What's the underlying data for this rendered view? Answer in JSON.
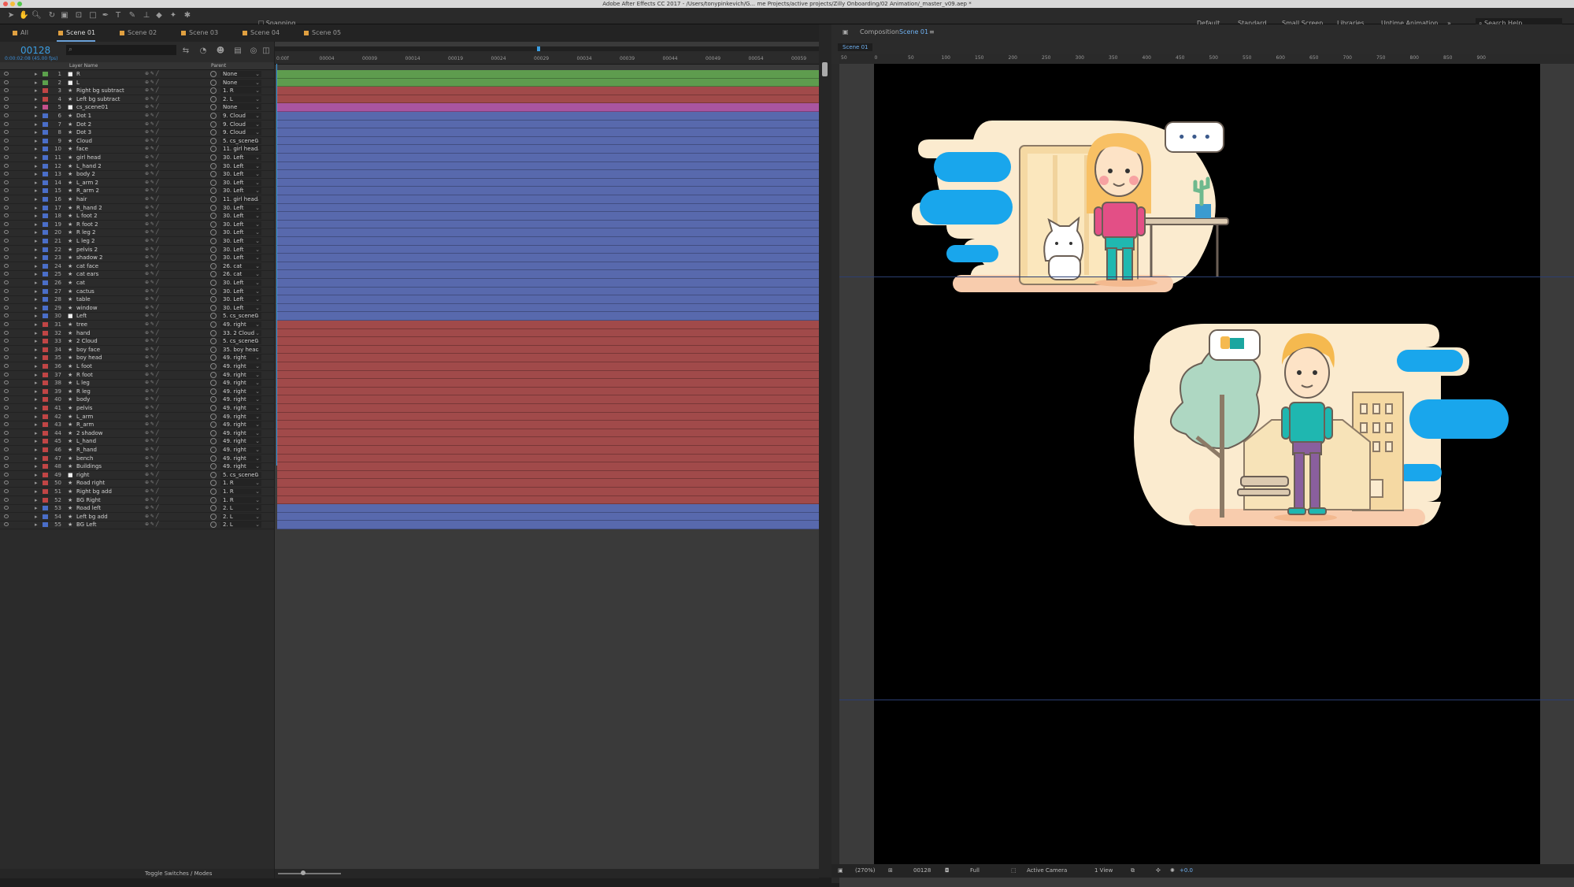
{
  "window_title": "Adobe After Effects CC 2017 - /Users/tonypinkevich/G... me Projects/active projects/Zilly Onboarding/02 Animation/_master_v09.aep *",
  "toolbar": {
    "snapping_label": "Snapping"
  },
  "workspaces": [
    "Default",
    "Standard",
    "Small Screen",
    "Libraries",
    "Untime Animation"
  ],
  "search_placeholder": "Search Help",
  "timeline_tabs": [
    {
      "label": "All",
      "color": "#e0a040"
    },
    {
      "label": "Scene 01",
      "color": "#e0a040",
      "active": true
    },
    {
      "label": "Scene 02",
      "color": "#e0a040"
    },
    {
      "label": "Scene 03",
      "color": "#e0a040"
    },
    {
      "label": "Scene 04",
      "color": "#e0a040"
    },
    {
      "label": "Scene 05",
      "color": "#e0a040"
    }
  ],
  "timecode": "00128",
  "fps_label": "0:00:02:08 (45.00 fps)",
  "layer_header": {
    "name": "Layer Name",
    "parent": "Parent"
  },
  "bottom_toggle": "Toggle Switches / Modes",
  "ruler_ticks": [
    "0:00f",
    "00004",
    "00009",
    "00014",
    "00019",
    "00024",
    "00029",
    "00034",
    "00039",
    "00044",
    "00049",
    "00054",
    "00059"
  ],
  "layers": [
    {
      "n": "1",
      "name": "R",
      "parent": "None",
      "label": "#5ca04c",
      "type": "square",
      "bar": "#5e9c4e"
    },
    {
      "n": "2",
      "name": "L",
      "parent": "None",
      "label": "#5ca04c",
      "type": "square",
      "bar": "#5e9c4e"
    },
    {
      "n": "3",
      "name": "Right bg subtract",
      "parent": "1. R",
      "label": "#c04545",
      "type": "star",
      "bar": "#a14a4a"
    },
    {
      "n": "4",
      "name": "Left bg subtract",
      "parent": "2. L",
      "label": "#c04545",
      "type": "star",
      "bar": "#a14a4a"
    },
    {
      "n": "5",
      "name": "cs_scene01",
      "parent": "None",
      "label": "#c4508c",
      "type": "square",
      "bar": "#a955a0"
    },
    {
      "n": "6",
      "name": "Dot 1",
      "parent": "9. Cloud",
      "label": "#4a6ec8",
      "type": "star",
      "bar": "#5869ad"
    },
    {
      "n": "7",
      "name": "Dot 2",
      "parent": "9. Cloud",
      "label": "#4a6ec8",
      "type": "star",
      "bar": "#5869ad"
    },
    {
      "n": "8",
      "name": "Dot 3",
      "parent": "9. Cloud",
      "label": "#4a6ec8",
      "type": "star",
      "bar": "#5869ad"
    },
    {
      "n": "9",
      "name": "Cloud",
      "parent": "5. cs_scene0",
      "label": "#4a6ec8",
      "type": "star",
      "bar": "#5869ad"
    },
    {
      "n": "10",
      "name": "face",
      "parent": "11. girl head",
      "label": "#4a6ec8",
      "type": "star",
      "bar": "#5869ad"
    },
    {
      "n": "11",
      "name": "girl head",
      "parent": "30. Left",
      "label": "#4a6ec8",
      "type": "star",
      "bar": "#5869ad"
    },
    {
      "n": "12",
      "name": "L_hand 2",
      "parent": "30. Left",
      "label": "#4a6ec8",
      "type": "star",
      "bar": "#5869ad"
    },
    {
      "n": "13",
      "name": "body 2",
      "parent": "30. Left",
      "label": "#4a6ec8",
      "type": "star",
      "bar": "#5869ad"
    },
    {
      "n": "14",
      "name": "L_arm 2",
      "parent": "30. Left",
      "label": "#4a6ec8",
      "type": "star",
      "bar": "#5869ad"
    },
    {
      "n": "15",
      "name": "R_arm 2",
      "parent": "30. Left",
      "label": "#4a6ec8",
      "type": "star",
      "bar": "#5869ad"
    },
    {
      "n": "16",
      "name": "hair",
      "parent": "11. girl head",
      "label": "#4a6ec8",
      "type": "star",
      "bar": "#5869ad"
    },
    {
      "n": "17",
      "name": "R_hand 2",
      "parent": "30. Left",
      "label": "#4a6ec8",
      "type": "star",
      "bar": "#5869ad"
    },
    {
      "n": "18",
      "name": "L foot 2",
      "parent": "30. Left",
      "label": "#4a6ec8",
      "type": "star",
      "bar": "#5869ad"
    },
    {
      "n": "19",
      "name": "R foot 2",
      "parent": "30. Left",
      "label": "#4a6ec8",
      "type": "star",
      "bar": "#5869ad"
    },
    {
      "n": "20",
      "name": "R leg 2",
      "parent": "30. Left",
      "label": "#4a6ec8",
      "type": "star",
      "bar": "#5869ad"
    },
    {
      "n": "21",
      "name": "L leg 2",
      "parent": "30. Left",
      "label": "#4a6ec8",
      "type": "star",
      "bar": "#5869ad"
    },
    {
      "n": "22",
      "name": "pelvis 2",
      "parent": "30. Left",
      "label": "#4a6ec8",
      "type": "star",
      "bar": "#5869ad"
    },
    {
      "n": "23",
      "name": "shadow 2",
      "parent": "30. Left",
      "label": "#4a6ec8",
      "type": "star",
      "bar": "#5869ad"
    },
    {
      "n": "24",
      "name": "cat face",
      "parent": "26. cat",
      "label": "#4a6ec8",
      "type": "star",
      "bar": "#5869ad"
    },
    {
      "n": "25",
      "name": "cat ears",
      "parent": "26. cat",
      "label": "#4a6ec8",
      "type": "star",
      "bar": "#5869ad"
    },
    {
      "n": "26",
      "name": "cat",
      "parent": "30. Left",
      "label": "#4a6ec8",
      "type": "star",
      "bar": "#5869ad"
    },
    {
      "n": "27",
      "name": "cactus",
      "parent": "30. Left",
      "label": "#4a6ec8",
      "type": "star",
      "bar": "#5869ad"
    },
    {
      "n": "28",
      "name": "table",
      "parent": "30. Left",
      "label": "#4a6ec8",
      "type": "star",
      "bar": "#5869ad"
    },
    {
      "n": "29",
      "name": "window",
      "parent": "30. Left",
      "label": "#4a6ec8",
      "type": "star",
      "bar": "#5869ad"
    },
    {
      "n": "30",
      "name": "Left",
      "parent": "5. cs_scene0",
      "label": "#4a6ec8",
      "type": "square",
      "bar": "#5869ad"
    },
    {
      "n": "31",
      "name": "tree",
      "parent": "49. right",
      "label": "#c04545",
      "type": "star",
      "bar": "#a14a4a"
    },
    {
      "n": "32",
      "name": "hand",
      "parent": "33. 2 Cloud",
      "label": "#c04545",
      "type": "star",
      "bar": "#a14a4a"
    },
    {
      "n": "33",
      "name": "2 Cloud",
      "parent": "5. cs_scene0",
      "label": "#c04545",
      "type": "star",
      "bar": "#a14a4a"
    },
    {
      "n": "34",
      "name": "boy face",
      "parent": "35. boy heac",
      "label": "#c04545",
      "type": "star",
      "bar": "#a14a4a"
    },
    {
      "n": "35",
      "name": "boy head",
      "parent": "49. right",
      "label": "#c04545",
      "type": "star",
      "bar": "#a14a4a"
    },
    {
      "n": "36",
      "name": "L foot",
      "parent": "49. right",
      "label": "#c04545",
      "type": "star",
      "bar": "#a14a4a"
    },
    {
      "n": "37",
      "name": "R foot",
      "parent": "49. right",
      "label": "#c04545",
      "type": "star",
      "bar": "#a14a4a"
    },
    {
      "n": "38",
      "name": "L leg",
      "parent": "49. right",
      "label": "#c04545",
      "type": "star",
      "bar": "#a14a4a"
    },
    {
      "n": "39",
      "name": "R leg",
      "parent": "49. right",
      "label": "#c04545",
      "type": "star",
      "bar": "#a14a4a"
    },
    {
      "n": "40",
      "name": "body",
      "parent": "49. right",
      "label": "#c04545",
      "type": "star",
      "bar": "#a14a4a"
    },
    {
      "n": "41",
      "name": "pelvis",
      "parent": "49. right",
      "label": "#c04545",
      "type": "star",
      "bar": "#a14a4a"
    },
    {
      "n": "42",
      "name": "L_arm",
      "parent": "49. right",
      "label": "#c04545",
      "type": "star",
      "bar": "#a14a4a"
    },
    {
      "n": "43",
      "name": "R_arm",
      "parent": "49. right",
      "label": "#c04545",
      "type": "star",
      "bar": "#a14a4a"
    },
    {
      "n": "44",
      "name": "2 shadow",
      "parent": "49. right",
      "label": "#c04545",
      "type": "star",
      "bar": "#a14a4a"
    },
    {
      "n": "45",
      "name": "L_hand",
      "parent": "49. right",
      "label": "#c04545",
      "type": "star",
      "bar": "#a14a4a"
    },
    {
      "n": "46",
      "name": "R_hand",
      "parent": "49. right",
      "label": "#c04545",
      "type": "star",
      "bar": "#a14a4a"
    },
    {
      "n": "47",
      "name": "bench",
      "parent": "49. right",
      "label": "#c04545",
      "type": "star",
      "bar": "#a14a4a"
    },
    {
      "n": "48",
      "name": "Buildings",
      "parent": "49. right",
      "label": "#c04545",
      "type": "star",
      "bar": "#a14a4a"
    },
    {
      "n": "49",
      "name": "right",
      "parent": "5. cs_scene0",
      "label": "#c04545",
      "type": "square",
      "bar": "#a14a4a"
    },
    {
      "n": "50",
      "name": "Road right",
      "parent": "1. R",
      "label": "#c04545",
      "type": "star",
      "bar": "#a14a4a"
    },
    {
      "n": "51",
      "name": "Right bg add",
      "parent": "1. R",
      "label": "#c04545",
      "type": "star",
      "bar": "#a14a4a"
    },
    {
      "n": "52",
      "name": "BG Right",
      "parent": "1. R",
      "label": "#c04545",
      "type": "star",
      "bar": "#a14a4a"
    },
    {
      "n": "53",
      "name": "Road left",
      "parent": "2. L",
      "label": "#4a6ec8",
      "type": "star",
      "bar": "#5869ad"
    },
    {
      "n": "54",
      "name": "Left bg add",
      "parent": "2. L",
      "label": "#4a6ec8",
      "type": "star",
      "bar": "#5869ad"
    },
    {
      "n": "55",
      "name": "BG Left",
      "parent": "2. L",
      "label": "#4a6ec8",
      "type": "star",
      "bar": "#5869ad"
    }
  ],
  "composition": {
    "panel_label": "Composition",
    "name": "Scene 01",
    "tab": "Scene 01",
    "ruler_ticks": [
      "50",
      "0",
      "50",
      "100",
      "150",
      "200",
      "250",
      "300",
      "350",
      "400",
      "450",
      "500",
      "550",
      "600",
      "650",
      "700",
      "750",
      "800",
      "850",
      "900"
    ],
    "footer": {
      "zoom": "(270%)",
      "timecode": "00128",
      "resolution": "Full",
      "camera": "Active Camera",
      "views": "1 View",
      "exposure": "+0.0"
    }
  },
  "illustration": {
    "speech_bubble_dots": "• • •"
  }
}
